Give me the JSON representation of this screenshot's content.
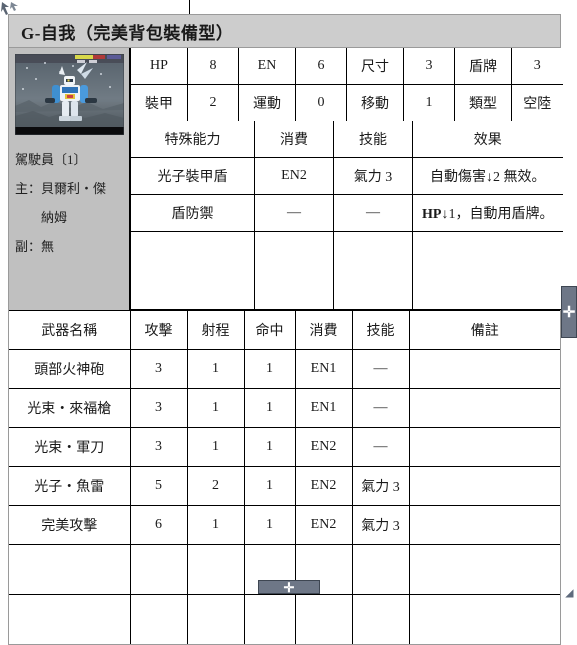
{
  "window": {
    "title_prefix": "G-",
    "title": "G-自我（完美背包裝備型）"
  },
  "unit": {
    "portrait_alt": "mecha-sprite",
    "pilot_label": "駕駛員〔1〕",
    "pilot_main_line1": "主：貝爾利・傑",
    "pilot_main_line2": "納姆",
    "pilot_sub": "副：無"
  },
  "stats": {
    "rows": [
      [
        {
          "label": "HP",
          "value": "8"
        },
        {
          "label": "EN",
          "value": "6"
        },
        {
          "label": "尺寸",
          "value": "3"
        },
        {
          "label": "盾牌",
          "value": "3"
        }
      ],
      [
        {
          "label": "裝甲",
          "value": "2"
        },
        {
          "label": "運動",
          "value": "0"
        },
        {
          "label": "移動",
          "value": "1"
        },
        {
          "label": "類型",
          "value": "空陸"
        }
      ]
    ]
  },
  "abilities": {
    "headers": [
      "特殊能力",
      "消費",
      "技能",
      "效果"
    ],
    "rows": [
      {
        "name": "光子裝甲盾",
        "cost": "EN2",
        "skill": "氣力 3",
        "effect": "自動傷害↓2 無效。",
        "effect_bold": ""
      },
      {
        "name": "盾防禦",
        "cost": "—",
        "skill": "—",
        "effect": "↓1，自動用盾牌。",
        "effect_bold": "HP"
      },
      {
        "name": "",
        "cost": "",
        "skill": "",
        "effect": "",
        "effect_bold": ""
      }
    ]
  },
  "weapons": {
    "headers": [
      "武器名稱",
      "攻擊",
      "射程",
      "命中",
      "消費",
      "技能",
      "備註"
    ],
    "rows": [
      {
        "name": "頭部火神砲",
        "attack": "3",
        "range": "1",
        "hit": "1",
        "cost": "EN1",
        "skill": "—",
        "note": ""
      },
      {
        "name": "光束・來福槍",
        "attack": "3",
        "range": "1",
        "hit": "1",
        "cost": "EN1",
        "skill": "—",
        "note": ""
      },
      {
        "name": "光束・軍刀",
        "attack": "3",
        "range": "1",
        "hit": "1",
        "cost": "EN2",
        "skill": "—",
        "note": ""
      },
      {
        "name": "光子・魚雷",
        "attack": "5",
        "range": "2",
        "hit": "1",
        "cost": "EN2",
        "skill": "氣力 3",
        "note": ""
      },
      {
        "name": "完美攻擊",
        "attack": "6",
        "range": "1",
        "hit": "1",
        "cost": "EN2",
        "skill": "氣力 3",
        "note": ""
      },
      {
        "name": "",
        "attack": "",
        "range": "",
        "hit": "",
        "cost": "",
        "skill": "",
        "note": ""
      },
      {
        "name": "",
        "attack": "",
        "range": "",
        "hit": "",
        "cost": "",
        "skill": "",
        "note": ""
      }
    ]
  },
  "controls": {
    "vscroll_glyph": "✛",
    "hscroll_glyph": "✛"
  },
  "colors": {
    "header_gray": "#c0c0c0",
    "title_gray": "#cdcdcd",
    "scroll_blue_gray": "#6e7787",
    "border": "#000000"
  }
}
